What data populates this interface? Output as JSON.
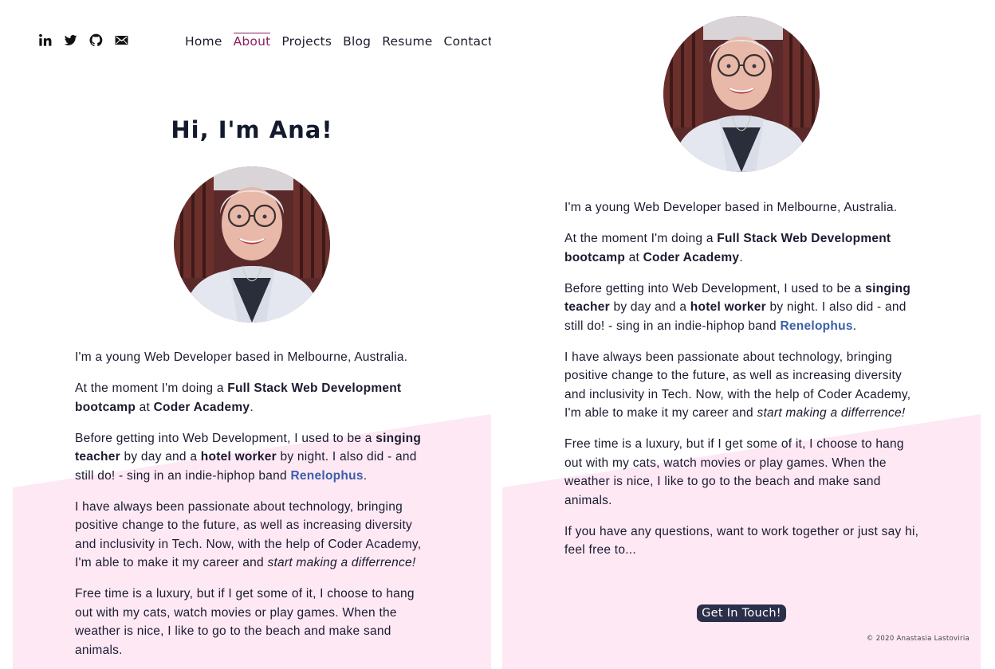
{
  "social": {
    "icons": [
      "linkedin-icon",
      "twitter-icon",
      "github-icon",
      "email-icon"
    ]
  },
  "nav": {
    "items": [
      "Home",
      "About",
      "Projects",
      "Blog",
      "Resume",
      "Contact"
    ],
    "active": "About"
  },
  "greeting": "Hi, I'm Ana!",
  "about": {
    "p1": "I'm a young Web Developer based in Melbourne, Australia.",
    "p2_a": "At the moment I'm doing a ",
    "p2_b": "Full Stack Web Development bootcamp",
    "p2_c": " at ",
    "p2_d": "Coder Academy",
    "p2_e": ".",
    "p3_a": "Before getting into Web Development, I used to be a ",
    "p3_b": "singing teacher",
    "p3_c": " by day and a ",
    "p3_d": "hotel worker",
    "p3_e": " by night. I also did - and still do! - sing in an indie-hiphop band ",
    "p3_link": "Renelophus",
    "p3_f": ".",
    "p4_a": "I have always been passionate about technology, bringing positive change to the future, as well as increasing diversity and inclusivity in Tech. Now, with the help of Coder Academy, I'm able to make it my career and ",
    "p4_b": "start making a differrence!",
    "p5": "Free time is a luxury, but if I get some of it, I choose to hang out with my cats, watch movies or play games. When the weather is nice, I like to go to the beach and make sand animals.",
    "p6": "If you have any questions, want to work together or just say hi, feel free to..."
  },
  "cta_label": "Get In Touch!",
  "copyright": "© 2020 Anastasia Lastoviria",
  "colors": {
    "accent": "#8b1e5f",
    "link": "#3a5fa8",
    "pink_bg": "#fde8f4",
    "button": "#2c2f4a"
  }
}
